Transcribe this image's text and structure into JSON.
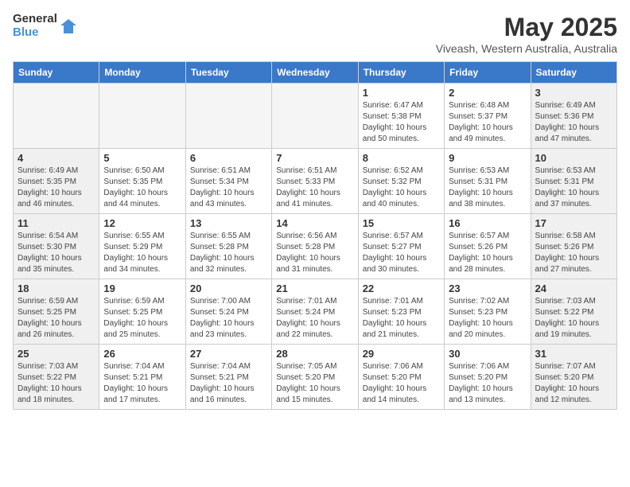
{
  "logo": {
    "line1": "General",
    "line2": "Blue"
  },
  "title": "May 2025",
  "subtitle": "Viveash, Western Australia, Australia",
  "days_of_week": [
    "Sunday",
    "Monday",
    "Tuesday",
    "Wednesday",
    "Thursday",
    "Friday",
    "Saturday"
  ],
  "weeks": [
    [
      {
        "num": "",
        "empty": true
      },
      {
        "num": "",
        "empty": true
      },
      {
        "num": "",
        "empty": true
      },
      {
        "num": "",
        "empty": true
      },
      {
        "num": "1",
        "info": "Sunrise: 6:47 AM\nSunset: 5:38 PM\nDaylight: 10 hours\nand 50 minutes."
      },
      {
        "num": "2",
        "info": "Sunrise: 6:48 AM\nSunset: 5:37 PM\nDaylight: 10 hours\nand 49 minutes."
      },
      {
        "num": "3",
        "info": "Sunrise: 6:49 AM\nSunset: 5:36 PM\nDaylight: 10 hours\nand 47 minutes.",
        "weekend": true
      }
    ],
    [
      {
        "num": "4",
        "info": "Sunrise: 6:49 AM\nSunset: 5:35 PM\nDaylight: 10 hours\nand 46 minutes.",
        "weekend": true
      },
      {
        "num": "5",
        "info": "Sunrise: 6:50 AM\nSunset: 5:35 PM\nDaylight: 10 hours\nand 44 minutes."
      },
      {
        "num": "6",
        "info": "Sunrise: 6:51 AM\nSunset: 5:34 PM\nDaylight: 10 hours\nand 43 minutes."
      },
      {
        "num": "7",
        "info": "Sunrise: 6:51 AM\nSunset: 5:33 PM\nDaylight: 10 hours\nand 41 minutes."
      },
      {
        "num": "8",
        "info": "Sunrise: 6:52 AM\nSunset: 5:32 PM\nDaylight: 10 hours\nand 40 minutes."
      },
      {
        "num": "9",
        "info": "Sunrise: 6:53 AM\nSunset: 5:31 PM\nDaylight: 10 hours\nand 38 minutes."
      },
      {
        "num": "10",
        "info": "Sunrise: 6:53 AM\nSunset: 5:31 PM\nDaylight: 10 hours\nand 37 minutes.",
        "weekend": true
      }
    ],
    [
      {
        "num": "11",
        "info": "Sunrise: 6:54 AM\nSunset: 5:30 PM\nDaylight: 10 hours\nand 35 minutes.",
        "weekend": true
      },
      {
        "num": "12",
        "info": "Sunrise: 6:55 AM\nSunset: 5:29 PM\nDaylight: 10 hours\nand 34 minutes."
      },
      {
        "num": "13",
        "info": "Sunrise: 6:55 AM\nSunset: 5:28 PM\nDaylight: 10 hours\nand 32 minutes."
      },
      {
        "num": "14",
        "info": "Sunrise: 6:56 AM\nSunset: 5:28 PM\nDaylight: 10 hours\nand 31 minutes."
      },
      {
        "num": "15",
        "info": "Sunrise: 6:57 AM\nSunset: 5:27 PM\nDaylight: 10 hours\nand 30 minutes."
      },
      {
        "num": "16",
        "info": "Sunrise: 6:57 AM\nSunset: 5:26 PM\nDaylight: 10 hours\nand 28 minutes."
      },
      {
        "num": "17",
        "info": "Sunrise: 6:58 AM\nSunset: 5:26 PM\nDaylight: 10 hours\nand 27 minutes.",
        "weekend": true
      }
    ],
    [
      {
        "num": "18",
        "info": "Sunrise: 6:59 AM\nSunset: 5:25 PM\nDaylight: 10 hours\nand 26 minutes.",
        "weekend": true
      },
      {
        "num": "19",
        "info": "Sunrise: 6:59 AM\nSunset: 5:25 PM\nDaylight: 10 hours\nand 25 minutes."
      },
      {
        "num": "20",
        "info": "Sunrise: 7:00 AM\nSunset: 5:24 PM\nDaylight: 10 hours\nand 23 minutes."
      },
      {
        "num": "21",
        "info": "Sunrise: 7:01 AM\nSunset: 5:24 PM\nDaylight: 10 hours\nand 22 minutes."
      },
      {
        "num": "22",
        "info": "Sunrise: 7:01 AM\nSunset: 5:23 PM\nDaylight: 10 hours\nand 21 minutes."
      },
      {
        "num": "23",
        "info": "Sunrise: 7:02 AM\nSunset: 5:23 PM\nDaylight: 10 hours\nand 20 minutes."
      },
      {
        "num": "24",
        "info": "Sunrise: 7:03 AM\nSunset: 5:22 PM\nDaylight: 10 hours\nand 19 minutes.",
        "weekend": true
      }
    ],
    [
      {
        "num": "25",
        "info": "Sunrise: 7:03 AM\nSunset: 5:22 PM\nDaylight: 10 hours\nand 18 minutes.",
        "weekend": true
      },
      {
        "num": "26",
        "info": "Sunrise: 7:04 AM\nSunset: 5:21 PM\nDaylight: 10 hours\nand 17 minutes."
      },
      {
        "num": "27",
        "info": "Sunrise: 7:04 AM\nSunset: 5:21 PM\nDaylight: 10 hours\nand 16 minutes."
      },
      {
        "num": "28",
        "info": "Sunrise: 7:05 AM\nSunset: 5:20 PM\nDaylight: 10 hours\nand 15 minutes."
      },
      {
        "num": "29",
        "info": "Sunrise: 7:06 AM\nSunset: 5:20 PM\nDaylight: 10 hours\nand 14 minutes."
      },
      {
        "num": "30",
        "info": "Sunrise: 7:06 AM\nSunset: 5:20 PM\nDaylight: 10 hours\nand 13 minutes."
      },
      {
        "num": "31",
        "info": "Sunrise: 7:07 AM\nSunset: 5:20 PM\nDaylight: 10 hours\nand 12 minutes.",
        "weekend": true
      }
    ]
  ]
}
